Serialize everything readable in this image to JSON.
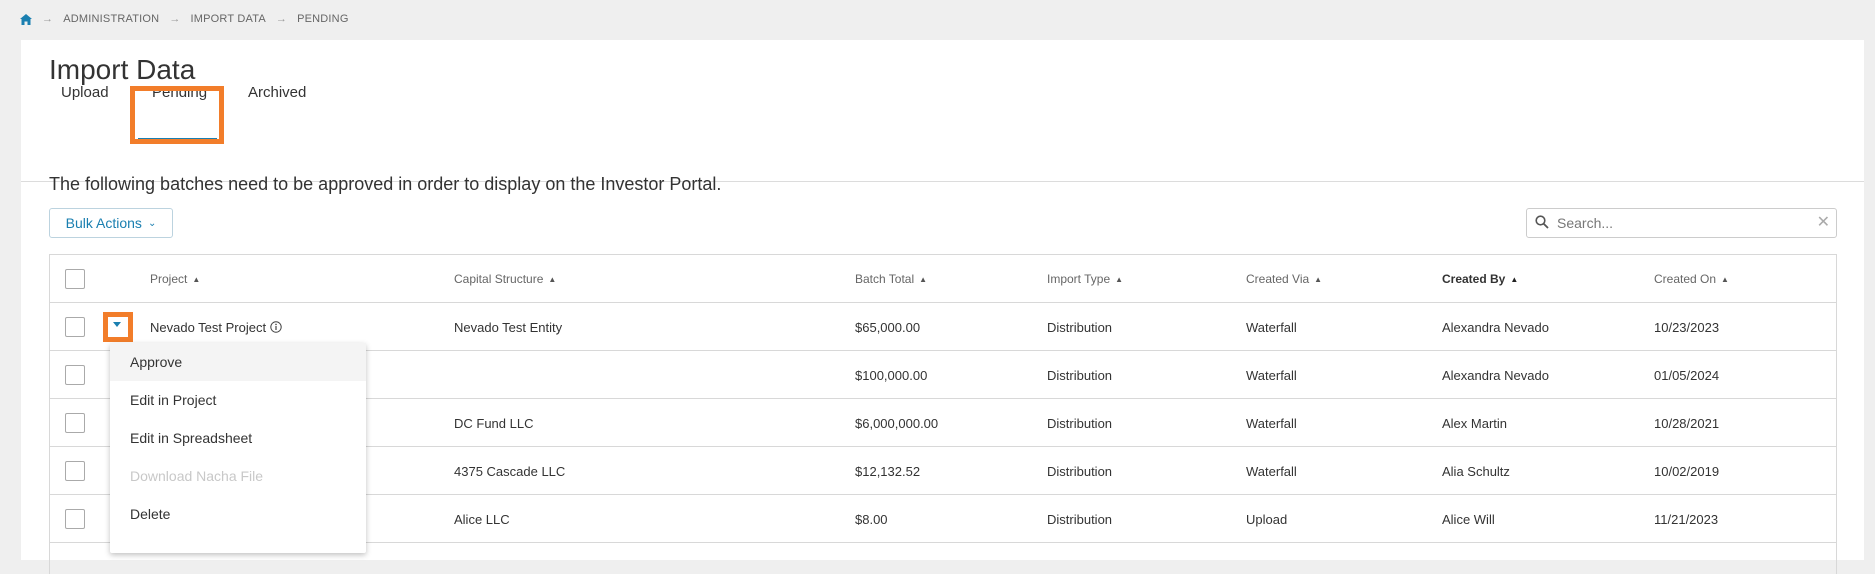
{
  "breadcrumb": {
    "items": [
      "ADMINISTRATION",
      "IMPORT DATA",
      "PENDING"
    ]
  },
  "page": {
    "title": "Import Data",
    "intro": "The following batches need to be approved in order to display on the Investor Portal."
  },
  "tabs": [
    {
      "label": "Upload"
    },
    {
      "label": "Pending",
      "active": true
    },
    {
      "label": "Archived"
    }
  ],
  "toolbar": {
    "bulk_actions_label": "Bulk Actions",
    "search_placeholder": "Search..."
  },
  "table": {
    "columns": [
      "Project",
      "Capital Structure",
      "Batch Total",
      "Import Type",
      "Created Via",
      "Created By",
      "Created On"
    ],
    "sorted_column": "Created By",
    "rows": [
      {
        "project": "Nevado Test Project",
        "capital_structure": "Nevado Test Entity",
        "batch_total": "$65,000.00",
        "import_type": "Distribution",
        "created_via": "Waterfall",
        "created_by": "Alexandra Nevado",
        "created_on": "10/23/2023"
      },
      {
        "project": "",
        "capital_structure": "",
        "batch_total": "$100,000.00",
        "import_type": "Distribution",
        "created_via": "Waterfall",
        "created_by": "Alexandra Nevado",
        "created_on": "01/05/2024"
      },
      {
        "project": "",
        "capital_structure": "DC Fund LLC",
        "batch_total": "$6,000,000.00",
        "import_type": "Distribution",
        "created_via": "Waterfall",
        "created_by": "Alex Martin",
        "created_on": "10/28/2021"
      },
      {
        "project": "",
        "capital_structure": "4375 Cascade LLC",
        "batch_total": "$12,132.52",
        "import_type": "Distribution",
        "created_via": "Waterfall",
        "created_by": "Alia Schultz",
        "created_on": "10/02/2019"
      },
      {
        "project": "",
        "capital_structure": "Alice LLC",
        "batch_total": "$8.00",
        "import_type": "Distribution",
        "created_via": "Upload",
        "created_by": "Alice Will",
        "created_on": "11/21/2023"
      }
    ]
  },
  "row_menu": {
    "items": [
      {
        "label": "Approve",
        "state": "hover"
      },
      {
        "label": "Edit in Project",
        "state": "enabled"
      },
      {
        "label": "Edit in Spreadsheet",
        "state": "enabled"
      },
      {
        "label": "Download Nacha File",
        "state": "disabled"
      },
      {
        "label": "Delete",
        "state": "enabled"
      }
    ]
  },
  "colors": {
    "accent": "#1a7fb0",
    "highlight": "#f27d2a",
    "background": "#efefef"
  },
  "icons": [
    "home-icon",
    "chevron-right-icon",
    "chevron-down-icon",
    "search-icon",
    "close-icon",
    "info-icon",
    "sort-up-icon",
    "caret-down-icon"
  ]
}
